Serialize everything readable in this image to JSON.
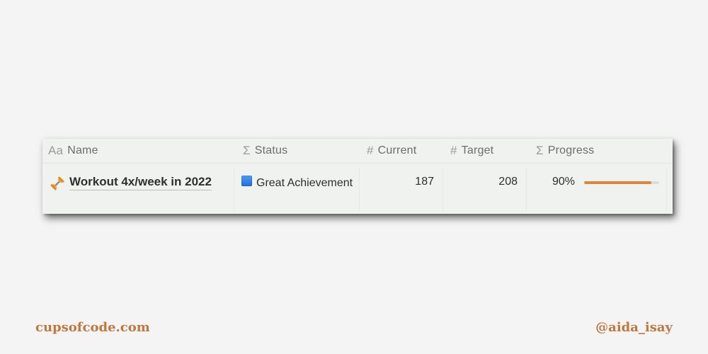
{
  "table": {
    "columns": [
      {
        "icon": "text-type-icon",
        "icon_glyph": "Aa",
        "label": "Name"
      },
      {
        "icon": "sigma-icon",
        "icon_glyph": "Σ",
        "label": "Status"
      },
      {
        "icon": "hash-icon",
        "icon_glyph": "#",
        "label": "Current"
      },
      {
        "icon": "hash-icon",
        "icon_glyph": "#",
        "label": "Target"
      },
      {
        "icon": "sigma-icon",
        "icon_glyph": "Σ",
        "label": "Progress"
      }
    ],
    "rows": [
      {
        "name_icon": "dumbbell-icon",
        "name": "Workout 4x/week in 2022",
        "status_icon": "blue-square-icon",
        "status": "Great Achievement",
        "current": "187",
        "target": "208",
        "progress_label": "90%",
        "progress_value": 0.9
      }
    ]
  },
  "colors": {
    "progress_fill": "#d9873d",
    "status_square": "#2f7ee8",
    "footer_text": "#c0783f"
  },
  "footer": {
    "left": "cupsofcode.com",
    "right": "@aida_isay"
  }
}
